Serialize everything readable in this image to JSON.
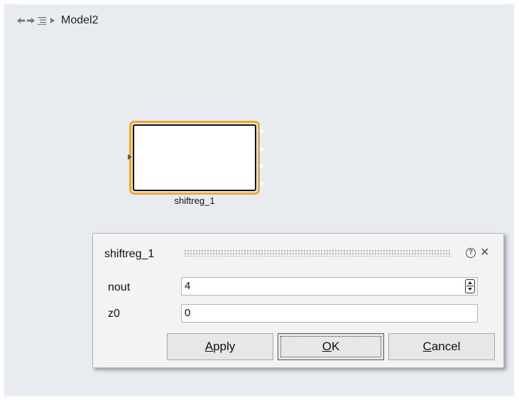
{
  "nav": {
    "back_icon": "arrow-left-icon",
    "forward_icon": "arrow-right-icon",
    "hierarchy_icon": "hierarchy-list-icon",
    "separator_icon": "chevron-right-icon",
    "model_name": "Model2"
  },
  "block": {
    "label": "shiftreg_1",
    "input_ports": 1,
    "output_ports": 4,
    "highlight_color": "#f5a623"
  },
  "dialog": {
    "title": "shiftreg_1",
    "help_icon": "help-icon",
    "help_glyph": "?",
    "close_icon": "close-icon",
    "close_glyph": "×",
    "params": [
      {
        "label": "nout",
        "value": "4"
      },
      {
        "label": "z0",
        "value": "0"
      }
    ],
    "buttons": {
      "apply_mnemonic": "A",
      "apply_rest": "pply",
      "ok_mnemonic": "O",
      "ok_rest": "K",
      "cancel_mnemonic": "C",
      "cancel_rest": "ancel"
    }
  }
}
